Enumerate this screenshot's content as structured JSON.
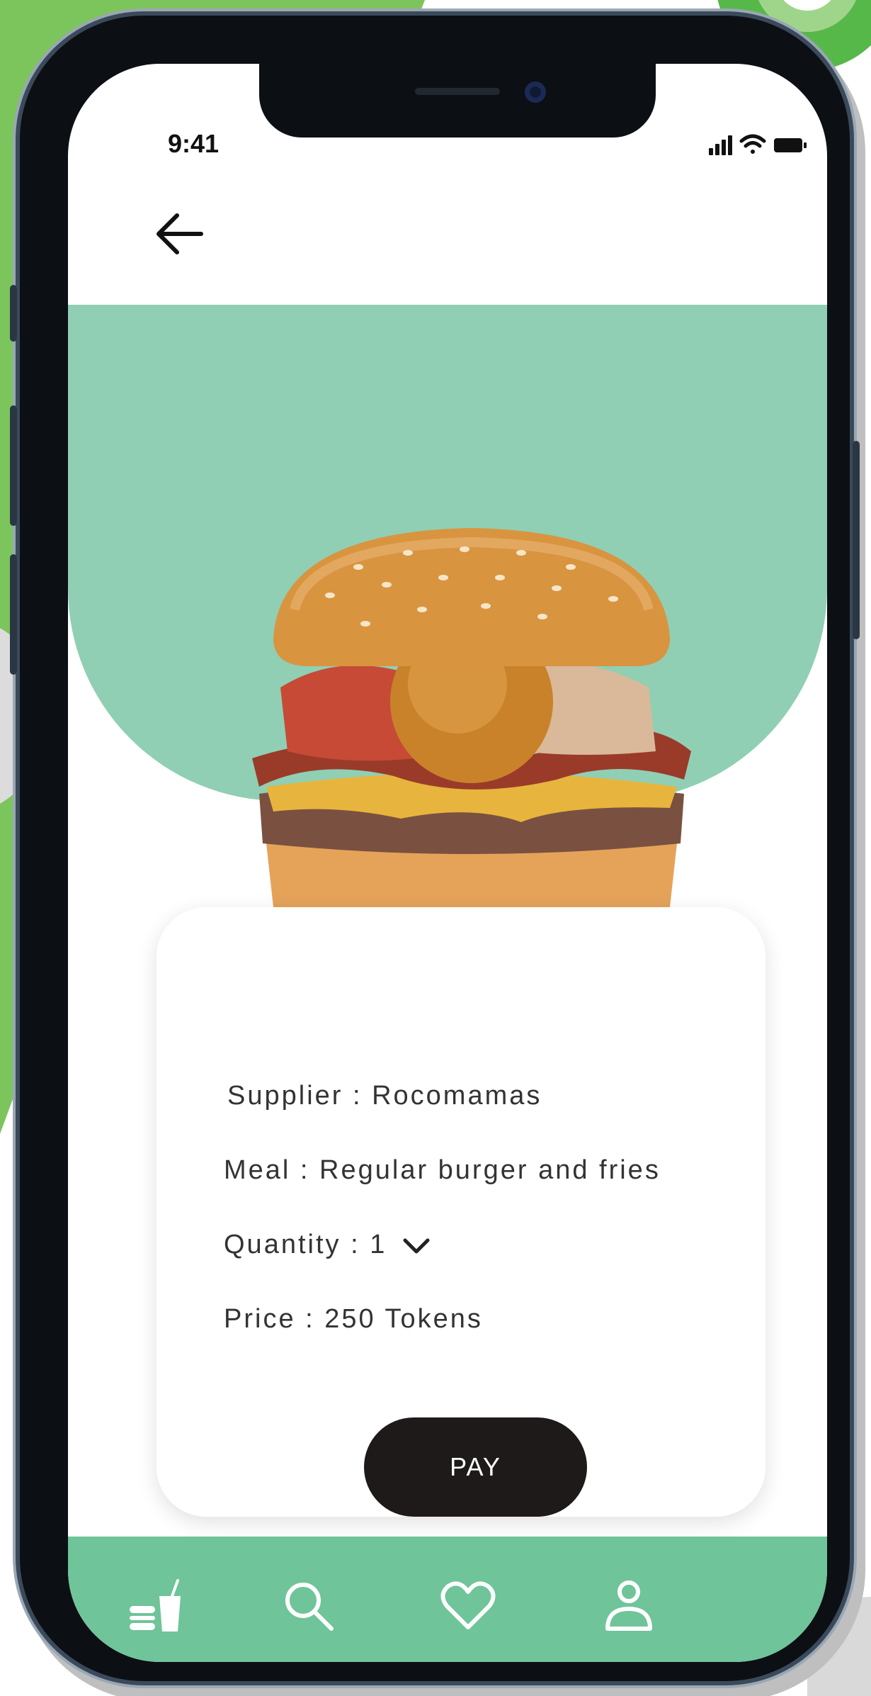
{
  "status_bar": {
    "time": "9:41"
  },
  "details": {
    "supplier": "Supplier : Rocomamas",
    "meal": "Meal : Regular burger and fries",
    "quantity": "Quantity : 1",
    "price": "Price : 250 Tokens"
  },
  "actions": {
    "pay_label": "PAY"
  },
  "icons": {
    "back": "arrow-left-icon",
    "quantity_dropdown": "chevron-down-icon",
    "nav": [
      "food-drink-icon",
      "search-icon",
      "heart-icon",
      "user-icon"
    ]
  },
  "colors": {
    "hero_band": "#90cfb4",
    "bottom_nav": "#6fc49a",
    "pay_button": "#1f1a1a",
    "background_accent": "#7cc45c"
  }
}
